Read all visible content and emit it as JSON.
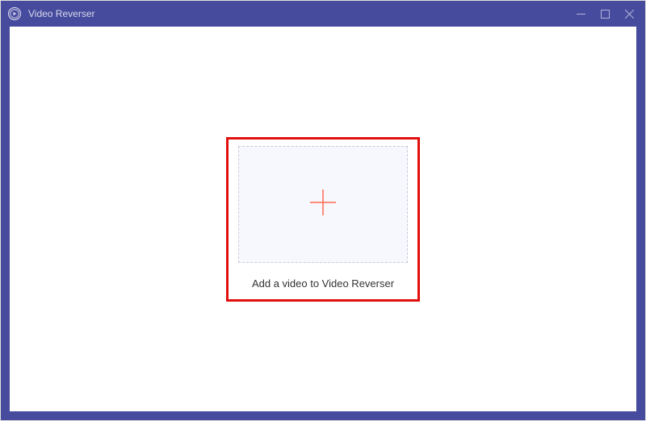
{
  "titlebar": {
    "app_title": "Video Reverser"
  },
  "main": {
    "drop_label": "Add a video to Video Reverser"
  }
}
